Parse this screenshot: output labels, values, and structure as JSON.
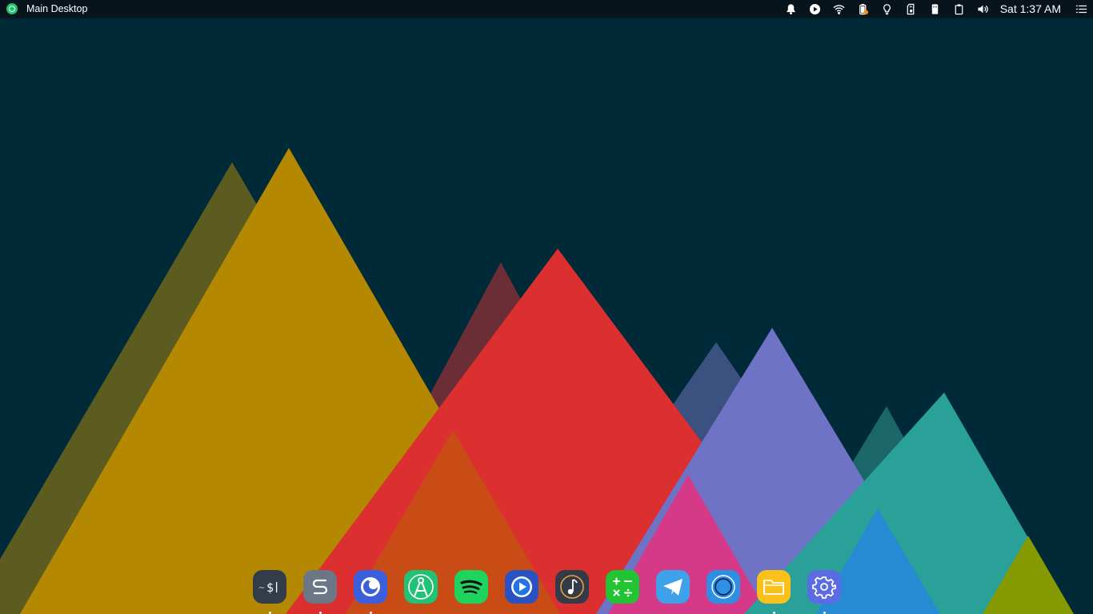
{
  "topbar": {
    "title": "Main Desktop",
    "clock": "Sat 1:37 AM",
    "tray_icons": [
      "bell-icon",
      "media-play-icon",
      "wifi-icon",
      "battery-icon",
      "bulb-icon",
      "sd-card-icon",
      "usb-drive-icon",
      "clipboard-icon",
      "volume-icon"
    ],
    "menu_icon": "list-menu-icon"
  },
  "dock": {
    "items": [
      {
        "name": "terminal",
        "icon": "terminal-icon",
        "color": "#333d4a",
        "running": true
      },
      {
        "name": "text-editor",
        "icon": "s-script-icon",
        "color": "#6b7686",
        "running": true
      },
      {
        "name": "firefox",
        "icon": "firefox-icon",
        "color": "#3c5fdd",
        "running": true
      },
      {
        "name": "android-studio",
        "icon": "compass-icon",
        "color": "#21c275",
        "running": false
      },
      {
        "name": "spotify",
        "icon": "spotify-icon",
        "color": "#1ed35e",
        "running": false
      },
      {
        "name": "media-player",
        "icon": "play-circle-icon",
        "color": "#2a52c4",
        "running": false
      },
      {
        "name": "music-player",
        "icon": "music-note-icon",
        "color": "#343b48",
        "running": false
      },
      {
        "name": "calculator",
        "icon": "calculator-icon",
        "color": "#22c433",
        "running": false
      },
      {
        "name": "telegram",
        "icon": "telegram-icon",
        "color": "#3ea1e9",
        "running": false
      },
      {
        "name": "browser",
        "icon": "circle-browser-icon",
        "color": "#2e8fe3",
        "running": false
      },
      {
        "name": "files",
        "icon": "folder-icon",
        "color": "#f9c11a",
        "running": true
      },
      {
        "name": "settings",
        "icon": "gear-icon",
        "color": "#5b6be3",
        "running": true
      }
    ]
  }
}
